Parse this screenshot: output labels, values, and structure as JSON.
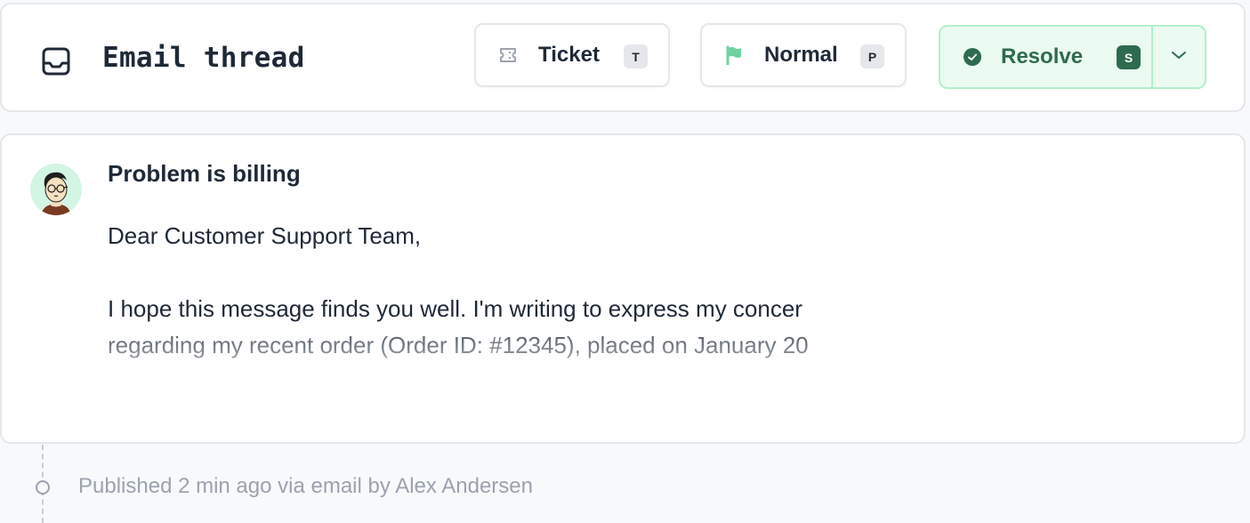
{
  "header": {
    "title": "Email thread",
    "icon": "inbox-icon"
  },
  "actions": {
    "ticket": {
      "label": "Ticket",
      "shortcut": "T",
      "icon": "ticket-icon"
    },
    "priority": {
      "label": "Normal",
      "shortcut": "P",
      "icon": "flag-icon",
      "icon_color": "#6fd39f"
    },
    "resolve": {
      "label": "Resolve",
      "shortcut": "S",
      "icon": "check-circle-icon",
      "dropdown_icon": "chevron-down-icon",
      "accent": "#2e6b4e"
    }
  },
  "message": {
    "subject": "Problem is billing",
    "avatar": "user-avatar",
    "body_lines": [
      "Dear Customer Support Team,",
      "",
      "I hope this message finds you well. I'm writing to express my concer",
      "regarding my recent order (Order ID: #12345), placed on January 20"
    ]
  },
  "timeline": {
    "meta": "Published 2 min ago via email by Alex Andersen"
  }
}
